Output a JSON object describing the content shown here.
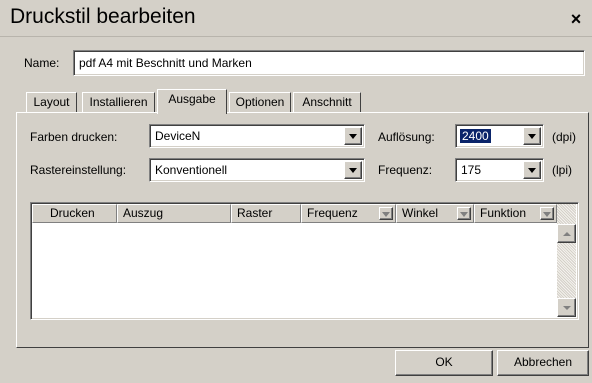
{
  "window": {
    "title": "Druckstil bearbeiten",
    "close_label": "×"
  },
  "name_field": {
    "label": "Name:",
    "value": "pdf A4 mit Beschnitt und Marken"
  },
  "tabs": [
    {
      "label": "Layout",
      "active": false
    },
    {
      "label": "Installieren",
      "active": false
    },
    {
      "label": "Ausgabe",
      "active": true
    },
    {
      "label": "Optionen",
      "active": false
    },
    {
      "label": "Anschnitt",
      "active": false
    }
  ],
  "ausgabe": {
    "farben_label": "Farben drucken:",
    "farben_value": "DeviceN",
    "raster_label": "Rastereinstellung:",
    "raster_value": "Konventionell",
    "aufloesung_label": "Auflösung:",
    "aufloesung_value": "2400",
    "aufloesung_unit": "(dpi)",
    "frequenz_label": "Frequenz:",
    "frequenz_value": "175",
    "frequenz_unit": "(lpi)"
  },
  "plates_table": {
    "columns": [
      "Drucken",
      "Auszug",
      "Raster",
      "Frequenz",
      "Winkel",
      "Funktion"
    ],
    "rows": []
  },
  "buttons": {
    "ok": "OK",
    "cancel": "Abbrechen"
  }
}
